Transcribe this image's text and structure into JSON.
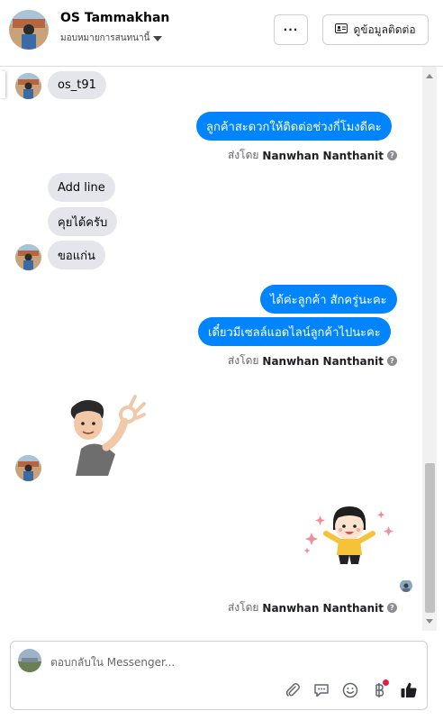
{
  "header": {
    "name": "OS Tammakhan",
    "assign_label": "มอบหมายการสนทนานี้",
    "more_label": "···",
    "contact_label": "ดูข้อมูลติดต่อ"
  },
  "messages": {
    "in_1": "os_t91",
    "out_1": "ลูกค้าสะดวกให้ติดต่อช่วงกี่โมงดีคะ",
    "in_2": "Add line",
    "in_3": "คุยได้ครับ",
    "in_4": "ขอแก่น",
    "out_2": "ได้ค่ะลูกค้า สักครู่นะคะ",
    "out_3": "เดี๋ยวมีเซลล์แอดไลน์ลูกค้าไปนะคะ"
  },
  "sent_by": {
    "prefix": "ส่งโดย",
    "name": "Nanwhan Nanthanit",
    "help": "?"
  },
  "composer": {
    "placeholder": "ตอบกลับใน Messenger..."
  },
  "icons": {
    "attach": "paperclip-icon",
    "saved_replies": "speech-bubble-icon",
    "emoji": "smiley-icon",
    "payment": "baht-icon",
    "like": "thumbs-up-icon"
  },
  "colors": {
    "outgoing_bubble": "#0084ff",
    "incoming_bubble": "#e4e6eb",
    "notify_dot": "#e41e3f"
  }
}
